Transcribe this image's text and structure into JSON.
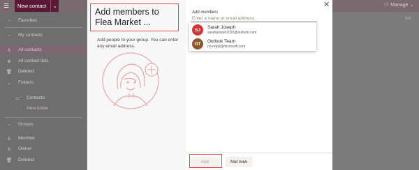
{
  "app": {
    "new_contact_label": "New contact",
    "manage_label": "Manage"
  },
  "sidebar": {
    "favorites": "Favorites",
    "my_contacts": "My contacts",
    "items": [
      {
        "label": "All contacts",
        "icon": "person-icon"
      },
      {
        "label": "All contact lists",
        "icon": "list-icon"
      },
      {
        "label": "Deleted",
        "icon": "trash-icon"
      },
      {
        "label": "Folders",
        "icon": "folder-icon"
      }
    ],
    "folder_items": [
      "Contacts",
      "New folder"
    ],
    "groups_header": "Groups",
    "group_items": [
      {
        "label": "Member",
        "icon": "person-icon"
      },
      {
        "label": "Owner",
        "icon": "person-icon"
      },
      {
        "label": "Deleted",
        "icon": "trash-icon"
      }
    ]
  },
  "dialog": {
    "title": "Add members to Flea Market ...",
    "description": "Add people to your group. You can enter any email address.",
    "field_label": "Add members",
    "field_placeholder": "Enter a name or email address",
    "suggestions": [
      {
        "initials": "SJ",
        "name": "Sarah Joseph",
        "email": "sarahjoseph2020@outlook.com",
        "color": "#d13438"
      },
      {
        "initials": "OT",
        "name": "Outlook Team",
        "email": "no-reply@microsoft.com",
        "color": "#8e562e"
      }
    ],
    "add_button": "Add",
    "not_now_button": "Not now",
    "highlight_color": "#e04a4a"
  }
}
